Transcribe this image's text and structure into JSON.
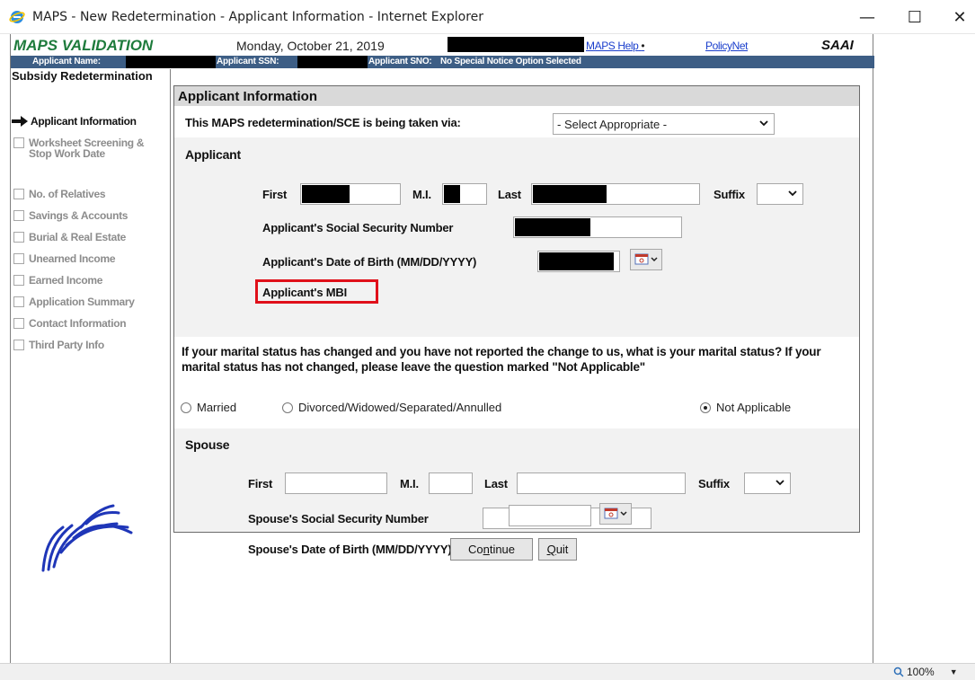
{
  "window": {
    "title": "MAPS - New Redetermination - Applicant Information - Internet Explorer",
    "minimize": "—",
    "maximize": "☐",
    "close": "✕"
  },
  "header": {
    "brand": "MAPS VALIDATION",
    "date": "Monday, October 21, 2019",
    "help_link": "MAPS Help",
    "help_bullet": "•",
    "policy_link": "PolicyNet",
    "app_code": "SAAI"
  },
  "info_bar": {
    "name_label": "Applicant Name:",
    "ssn_label": "Applicant SSN:",
    "sno_label": "Applicant SNO:",
    "sno_value": "No Special Notice Option Selected"
  },
  "sidebar": {
    "title": "Subsidy Redetermination",
    "current": "Applicant Information",
    "items": [
      {
        "label": "Worksheet Screening & Stop Work Date"
      },
      {
        "label": "No. of Relatives"
      },
      {
        "label": "Savings & Accounts"
      },
      {
        "label": "Burial & Real Estate"
      },
      {
        "label": "Unearned Income"
      },
      {
        "label": "Earned Income"
      },
      {
        "label": "Application Summary"
      },
      {
        "label": "Contact Information"
      },
      {
        "label": "Third Party Info"
      }
    ]
  },
  "form": {
    "heading": "Applicant Information",
    "via_label": "This MAPS redetermination/SCE is being taken via:",
    "via_selected": "- Select Appropriate -",
    "applicant_heading": "Applicant",
    "first_label": "First",
    "mi_label": "M.I.",
    "last_label": "Last",
    "suffix_label": "Suffix",
    "ssn_label": "Applicant's Social Security Number",
    "dob_label": "Applicant's Date of Birth (MM/DD/YYYY)",
    "mbi_label": "Applicant's MBI",
    "marital_question": "If your marital status has changed and you have not reported the change to us, what is your marital status? If your marital status has not changed, please leave the question marked \"Not Applicable\"",
    "marital_options": [
      {
        "label": "Married",
        "selected": false
      },
      {
        "label": "Divorced/Widowed/Separated/Annulled",
        "selected": false
      },
      {
        "label": "Not Applicable",
        "selected": true
      }
    ],
    "spouse_heading": "Spouse",
    "spouse_first_label": "First",
    "spouse_mi_label": "M.I.",
    "spouse_last_label": "Last",
    "spouse_suffix_label": "Suffix",
    "spouse_ssn_label": "Spouse's Social Security Number",
    "spouse_dob_label": "Spouse's Date of Birth (MM/DD/YYYY)"
  },
  "buttons": {
    "continue_label": "Continue",
    "quit_label": "Quit"
  },
  "statusbar": {
    "zoom": "100%"
  },
  "colors": {
    "brand_green": "#1e7b3c",
    "info_bar_blue": "#3d5e85",
    "link_blue": "#1a3ecc",
    "highlight_red": "#e0101a"
  }
}
